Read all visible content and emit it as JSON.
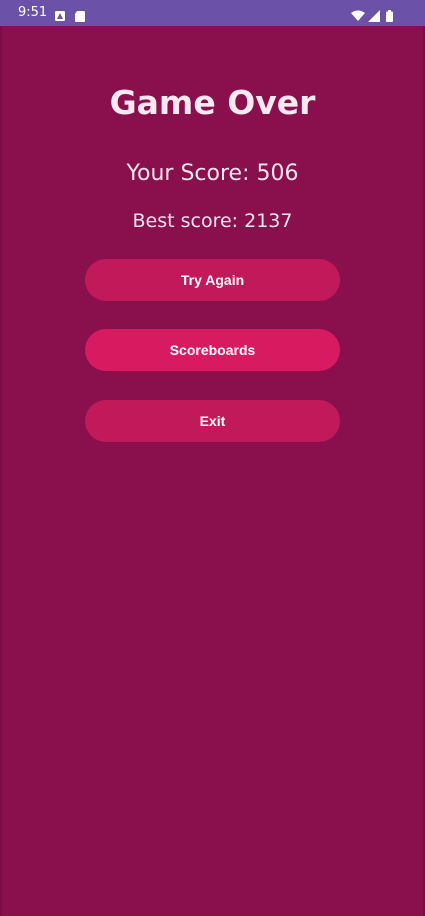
{
  "status_bar": {
    "time": "9:51",
    "left_icons": [
      "sim-card-icon",
      "sd-card-icon"
    ],
    "right_icons": [
      "wifi-icon",
      "cell-signal-icon",
      "battery-icon"
    ],
    "bar_color": "#6b52a8"
  },
  "game_over": {
    "title": "Game Over",
    "your_score": "Your Score: 506",
    "best_score": "Best score: 2137"
  },
  "buttons": {
    "try_again": "Try Again",
    "scoreboards": "Scoreboards",
    "exit": "Exit"
  },
  "colors": {
    "background": "#8a0f4d",
    "button": "#c2195a",
    "button_highlight": "#d81b60",
    "text": "#f8e9f0"
  }
}
